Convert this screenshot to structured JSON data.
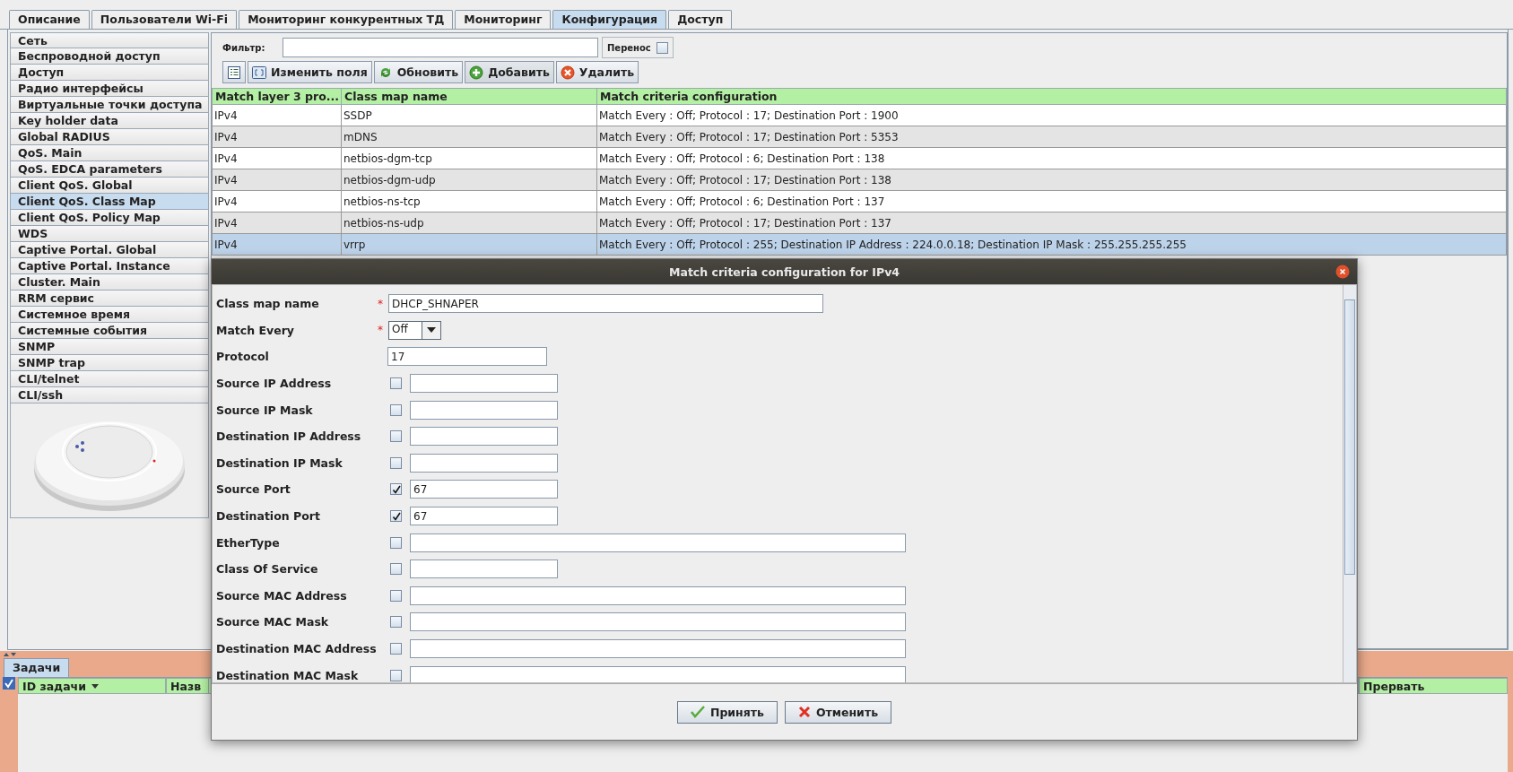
{
  "tabs": [
    {
      "label": "Описание",
      "selected": false
    },
    {
      "label": "Пользователи Wi-Fi",
      "selected": false
    },
    {
      "label": "Мониторинг конкурентных ТД",
      "selected": false
    },
    {
      "label": "Мониторинг",
      "selected": false
    },
    {
      "label": "Конфигурация",
      "selected": true
    },
    {
      "label": "Доступ",
      "selected": false
    }
  ],
  "sidebar": {
    "items": [
      {
        "label": "Сеть",
        "selected": false
      },
      {
        "label": "Беспроводной доступ",
        "selected": false
      },
      {
        "label": "Доступ",
        "selected": false
      },
      {
        "label": "Радио интерфейсы",
        "selected": false
      },
      {
        "label": "Виртуальные точки доступа",
        "selected": false
      },
      {
        "label": "Key holder data",
        "selected": false
      },
      {
        "label": "Global RADIUS",
        "selected": false
      },
      {
        "label": "QoS. Main",
        "selected": false
      },
      {
        "label": "QoS. EDCA parameters",
        "selected": false
      },
      {
        "label": "Client QoS. Global",
        "selected": false
      },
      {
        "label": "Client QoS. Class Map",
        "selected": true
      },
      {
        "label": "Client QoS. Policy Map",
        "selected": false
      },
      {
        "label": "WDS",
        "selected": false
      },
      {
        "label": "Captive Portal. Global",
        "selected": false
      },
      {
        "label": "Captive Portal. Instance",
        "selected": false
      },
      {
        "label": "Cluster. Main",
        "selected": false
      },
      {
        "label": "RRM сервис",
        "selected": false
      },
      {
        "label": "Системное время",
        "selected": false
      },
      {
        "label": "Системные события",
        "selected": false
      },
      {
        "label": "SNMP",
        "selected": false
      },
      {
        "label": "SNMP trap",
        "selected": false
      },
      {
        "label": "CLI/telnet",
        "selected": false
      },
      {
        "label": "CLI/ssh",
        "selected": false
      }
    ]
  },
  "filter": {
    "label": "Фильтр:"
  },
  "wrap": {
    "label": "Перенос",
    "checked": false
  },
  "toolbar": [
    {
      "kind": "columns"
    },
    {
      "kind": "edit",
      "label": "Изменить поля"
    },
    {
      "kind": "refresh",
      "label": "Обновить"
    },
    {
      "kind": "add",
      "label": "Добавить"
    },
    {
      "kind": "delete",
      "label": "Удалить"
    }
  ],
  "table": {
    "columns": [
      "Match layer 3 pro...",
      "Class map name",
      "Match criteria configuration"
    ],
    "rows": [
      {
        "cells": [
          "IPv4",
          "SSDP",
          "Match Every : Off; Protocol : 17; Destination Port : 1900"
        ],
        "selected": false
      },
      {
        "cells": [
          "IPv4",
          "mDNS",
          "Match Every : Off; Protocol : 17; Destination Port : 5353"
        ],
        "selected": false
      },
      {
        "cells": [
          "IPv4",
          "netbios-dgm-tcp",
          "Match Every : Off; Protocol : 6; Destination Port : 138"
        ],
        "selected": false
      },
      {
        "cells": [
          "IPv4",
          "netbios-dgm-udp",
          "Match Every : Off; Protocol : 17; Destination Port : 138"
        ],
        "selected": false
      },
      {
        "cells": [
          "IPv4",
          "netbios-ns-tcp",
          "Match Every : Off; Protocol : 6; Destination Port : 137"
        ],
        "selected": false
      },
      {
        "cells": [
          "IPv4",
          "netbios-ns-udp",
          "Match Every : Off; Protocol : 17; Destination Port : 137"
        ],
        "selected": false
      },
      {
        "cells": [
          "IPv4",
          "vrrp",
          "Match Every : Off; Protocol : 255; Destination IP Address : 224.0.0.18; Destination IP Mask : 255.255.255.255"
        ],
        "selected": true
      }
    ]
  },
  "dialog": {
    "title": "Match criteria configuration for IPv4",
    "fields": [
      {
        "label": "Class map name",
        "kind": "wide-text",
        "required_mark": "*",
        "value": "DHCP_SHNAPER"
      },
      {
        "label": "Match Every",
        "kind": "select",
        "required_mark": "*",
        "value": "Off"
      },
      {
        "label": "Protocol",
        "kind": "text",
        "value": "17"
      },
      {
        "label": "Source IP Address",
        "kind": "check-short",
        "checked": false
      },
      {
        "label": "Source IP Mask",
        "kind": "check-short",
        "checked": false
      },
      {
        "label": "Destination IP Address",
        "kind": "check-short",
        "checked": false
      },
      {
        "label": "Destination IP Mask",
        "kind": "check-short",
        "checked": false
      },
      {
        "label": "Source Port",
        "kind": "check-short",
        "checked": true,
        "value": "67"
      },
      {
        "label": "Destination Port",
        "kind": "check-short",
        "checked": true,
        "value": "67"
      },
      {
        "label": "EtherType",
        "kind": "check-wide",
        "checked": false
      },
      {
        "label": "Class Of Service",
        "kind": "check-short",
        "checked": false
      },
      {
        "label": "Source MAC Address",
        "kind": "check-wide",
        "checked": false
      },
      {
        "label": "Source MAC Mask",
        "kind": "check-wide",
        "checked": false
      },
      {
        "label": "Destination MAC Address",
        "kind": "check-wide",
        "checked": false
      },
      {
        "label": "Destination MAC Mask",
        "kind": "check-wide",
        "checked": false
      }
    ],
    "buttons": [
      {
        "kind": "accept",
        "label": "Принять"
      },
      {
        "kind": "cancel",
        "label": "Отменить"
      }
    ]
  },
  "tasks": {
    "tab": "Задачи",
    "columns": [
      "ID задачи",
      "Назв",
      "Прервать"
    ]
  }
}
